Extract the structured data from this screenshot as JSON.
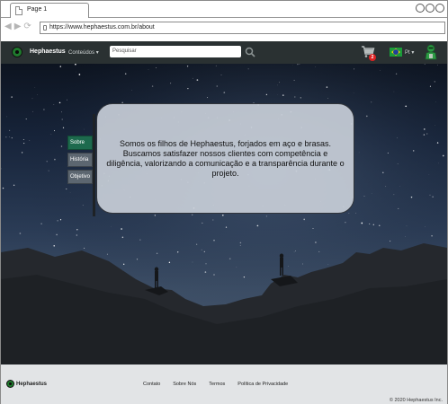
{
  "browser": {
    "tab_title": "Page 1",
    "url": "https://www.hephaestus.com.br/about",
    "nav_icons": [
      "back-icon",
      "forward-icon",
      "reload-icon"
    ]
  },
  "header": {
    "brand": "Hephaestus",
    "menu_label": "Conteúdos",
    "search_placeholder": "Pesquisar",
    "cart_count": "2",
    "language": "Pt"
  },
  "side_nav": {
    "items": [
      {
        "label": "Sobre",
        "active": true
      },
      {
        "label": "História",
        "active": false
      },
      {
        "label": "Objetivo",
        "active": false
      }
    ]
  },
  "about": {
    "text": "Somos os filhos de Hephaestus, forjados em aço e brasas. Buscamos satisfazer nossos clientes com competência e diligência, valorizando a comunicação e a transparência durante o projeto."
  },
  "footer": {
    "brand": "Hephaestus",
    "links": [
      "Contato",
      "Sobre Nós",
      "Termos",
      "Política de Privacidade"
    ],
    "copyright": "© 2020 Hephaestus Inc."
  },
  "colors": {
    "header_bg": "#2a3132",
    "brand_green": "#1f7a2d",
    "active_nav": "#1d6a4d",
    "footer_bg": "#e2e4e6"
  }
}
